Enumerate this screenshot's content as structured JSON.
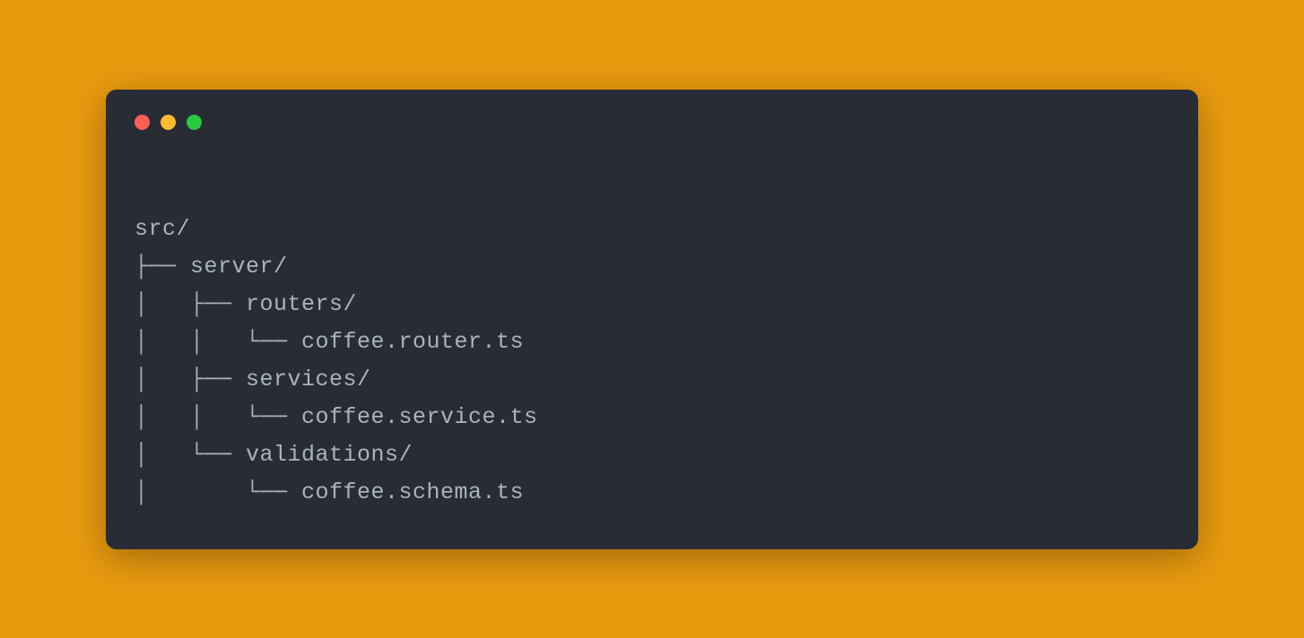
{
  "tree": {
    "lines": [
      "src/",
      "├── server/",
      "│   ├── routers/",
      "│   │   └── coffee.router.ts",
      "│   ├── services/",
      "│   │   └── coffee.service.ts",
      "│   └── validations/",
      "│       └── coffee.schema.ts"
    ]
  },
  "colors": {
    "background": "#e89a0f",
    "terminal_bg": "#282c34",
    "text": "#abb2bf",
    "red": "#ff5f57",
    "yellow": "#febc2e",
    "green": "#28c840"
  }
}
